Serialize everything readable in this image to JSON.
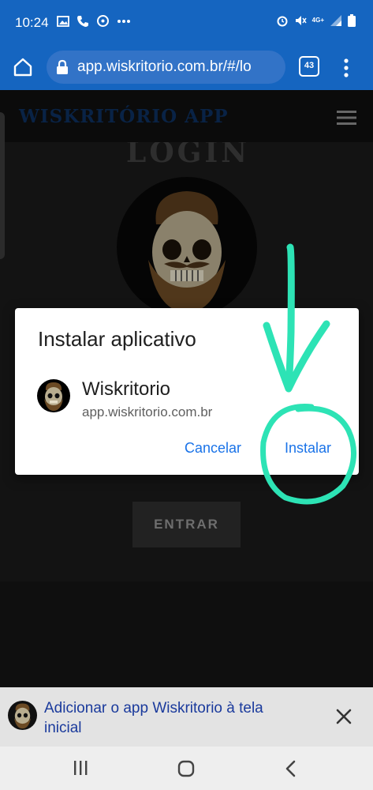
{
  "status_bar": {
    "time": "10:24",
    "left_icons": [
      "image-icon",
      "phone-icon",
      "sync-icon",
      "more-notifications-icon"
    ],
    "right_icons": [
      "alarm-icon",
      "mute-icon",
      "lte-icon",
      "signal-icon",
      "battery-icon"
    ],
    "lte_label": "4G+"
  },
  "browser": {
    "url": "app.wiskritorio.com.br/#/lo",
    "tab_count": "43"
  },
  "app_header": {
    "brand": "WISKRITÓRIO APP"
  },
  "page": {
    "login_heading_partial": "LOGIN",
    "enter_button": "ENTRAR"
  },
  "install_dialog": {
    "title": "Instalar aplicativo",
    "app_name": "Wiskritorio",
    "app_url": "app.wiskritorio.com.br",
    "cancel_label": "Cancelar",
    "install_label": "Instalar"
  },
  "add_to_home_bar": {
    "text": "Adicionar o app Wiskritorio à tela inicial"
  },
  "colors": {
    "chrome_blue": "#1565c0",
    "dialog_button": "#1a73e8",
    "annotation": "#2de3b5"
  }
}
